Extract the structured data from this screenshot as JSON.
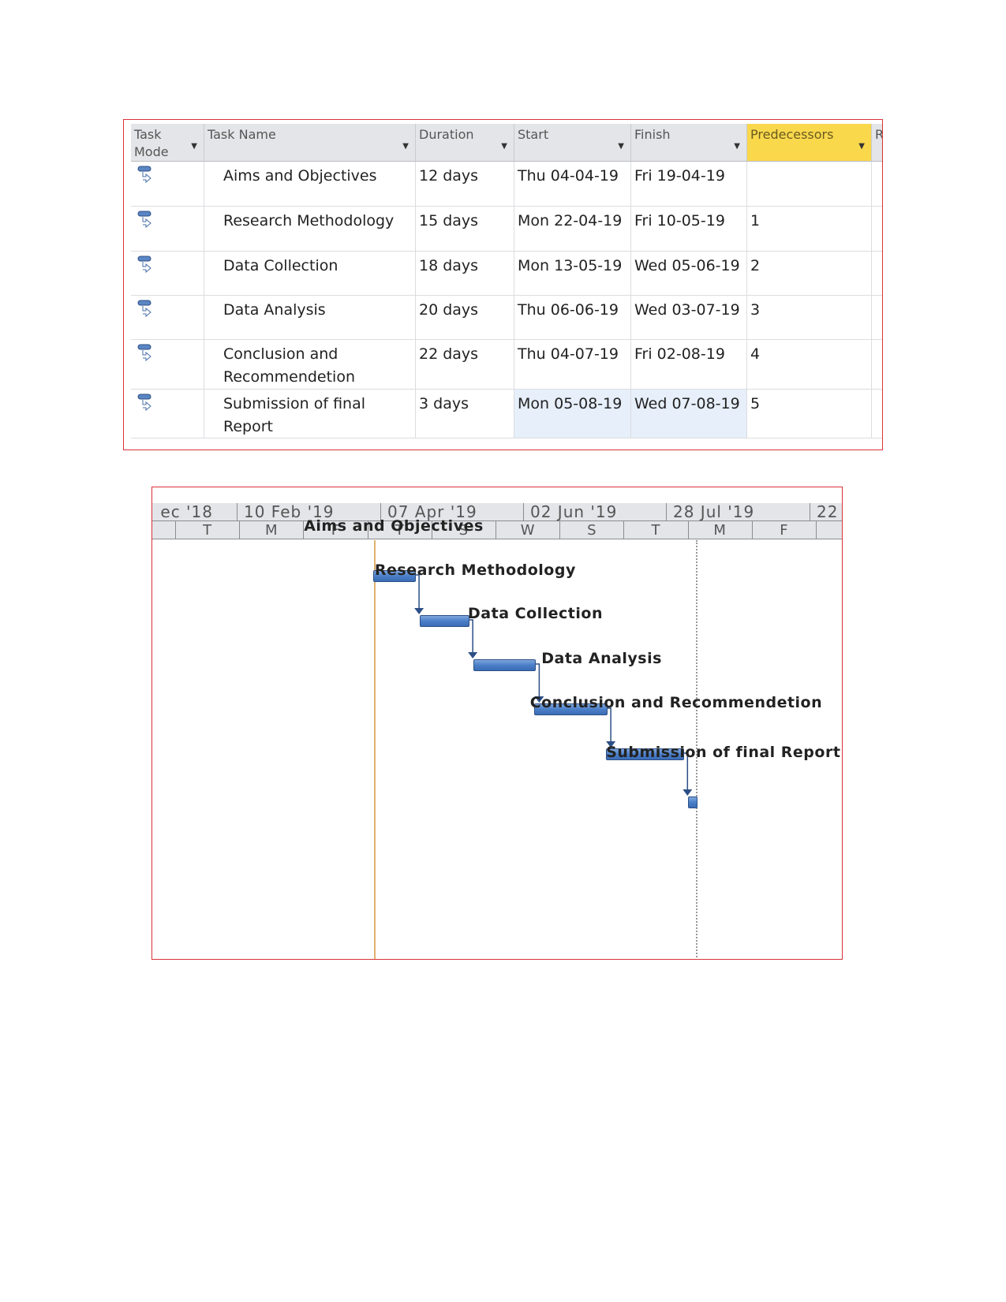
{
  "table": {
    "columns": [
      {
        "label": "Task Mode"
      },
      {
        "label": "Task Name"
      },
      {
        "label": "Duration"
      },
      {
        "label": "Start"
      },
      {
        "label": "Finish"
      },
      {
        "label": "Predecessors"
      },
      {
        "label": "R"
      }
    ],
    "rows": [
      {
        "name": "Aims and Objectives",
        "duration": "12 days",
        "start": "Thu 04-04-19",
        "finish": "Fri 19-04-19",
        "pred": ""
      },
      {
        "name": "Research Methodology",
        "duration": "15 days",
        "start": "Mon 22-04-19",
        "finish": "Fri 10-05-19",
        "pred": "1"
      },
      {
        "name": "Data Collection",
        "duration": "18 days",
        "start": "Mon 13-05-19",
        "finish": "Wed 05-06-19",
        "pred": "2"
      },
      {
        "name": "Data Analysis",
        "duration": "20 days",
        "start": "Thu 06-06-19",
        "finish": "Wed 03-07-19",
        "pred": "3"
      },
      {
        "name": "Conclusion and Recommendetion",
        "duration": "22 days",
        "start": "Thu 04-07-19",
        "finish": "Fri 02-08-19",
        "pred": "4"
      },
      {
        "name": "Submission of final Report",
        "duration": "3 days",
        "start": "Mon 05-08-19",
        "finish": "Wed 07-08-19",
        "pred": "5"
      }
    ],
    "icon": "auto-scheduled-task-icon",
    "highlight_color": "#f9d84c"
  },
  "gantt": {
    "major_ticks": [
      "ec '18",
      "10 Feb '19",
      "07 Apr '19",
      "02 Jun '19",
      "28 Jul '19",
      "22"
    ],
    "minor_ticks": [
      "",
      "T",
      "M",
      "F",
      "T",
      "S",
      "W",
      "S",
      "T",
      "M",
      "F",
      ""
    ],
    "bar_color": "#4a7fc8",
    "tasks": [
      {
        "label": "Aims and Objectives",
        "start": "2019-04-04",
        "finish": "2019-04-19"
      },
      {
        "label": "Research Methodology",
        "start": "2019-04-22",
        "finish": "2019-05-10"
      },
      {
        "label": "Data Collection",
        "start": "2019-05-13",
        "finish": "2019-06-05"
      },
      {
        "label": "Data Analysis",
        "start": "2019-06-06",
        "finish": "2019-07-03"
      },
      {
        "label": "Conclusion and Recommendetion",
        "start": "2019-07-04",
        "finish": "2019-08-02"
      },
      {
        "label": "Submission of final Report",
        "start": "2019-08-05",
        "finish": "2019-08-07"
      }
    ]
  }
}
